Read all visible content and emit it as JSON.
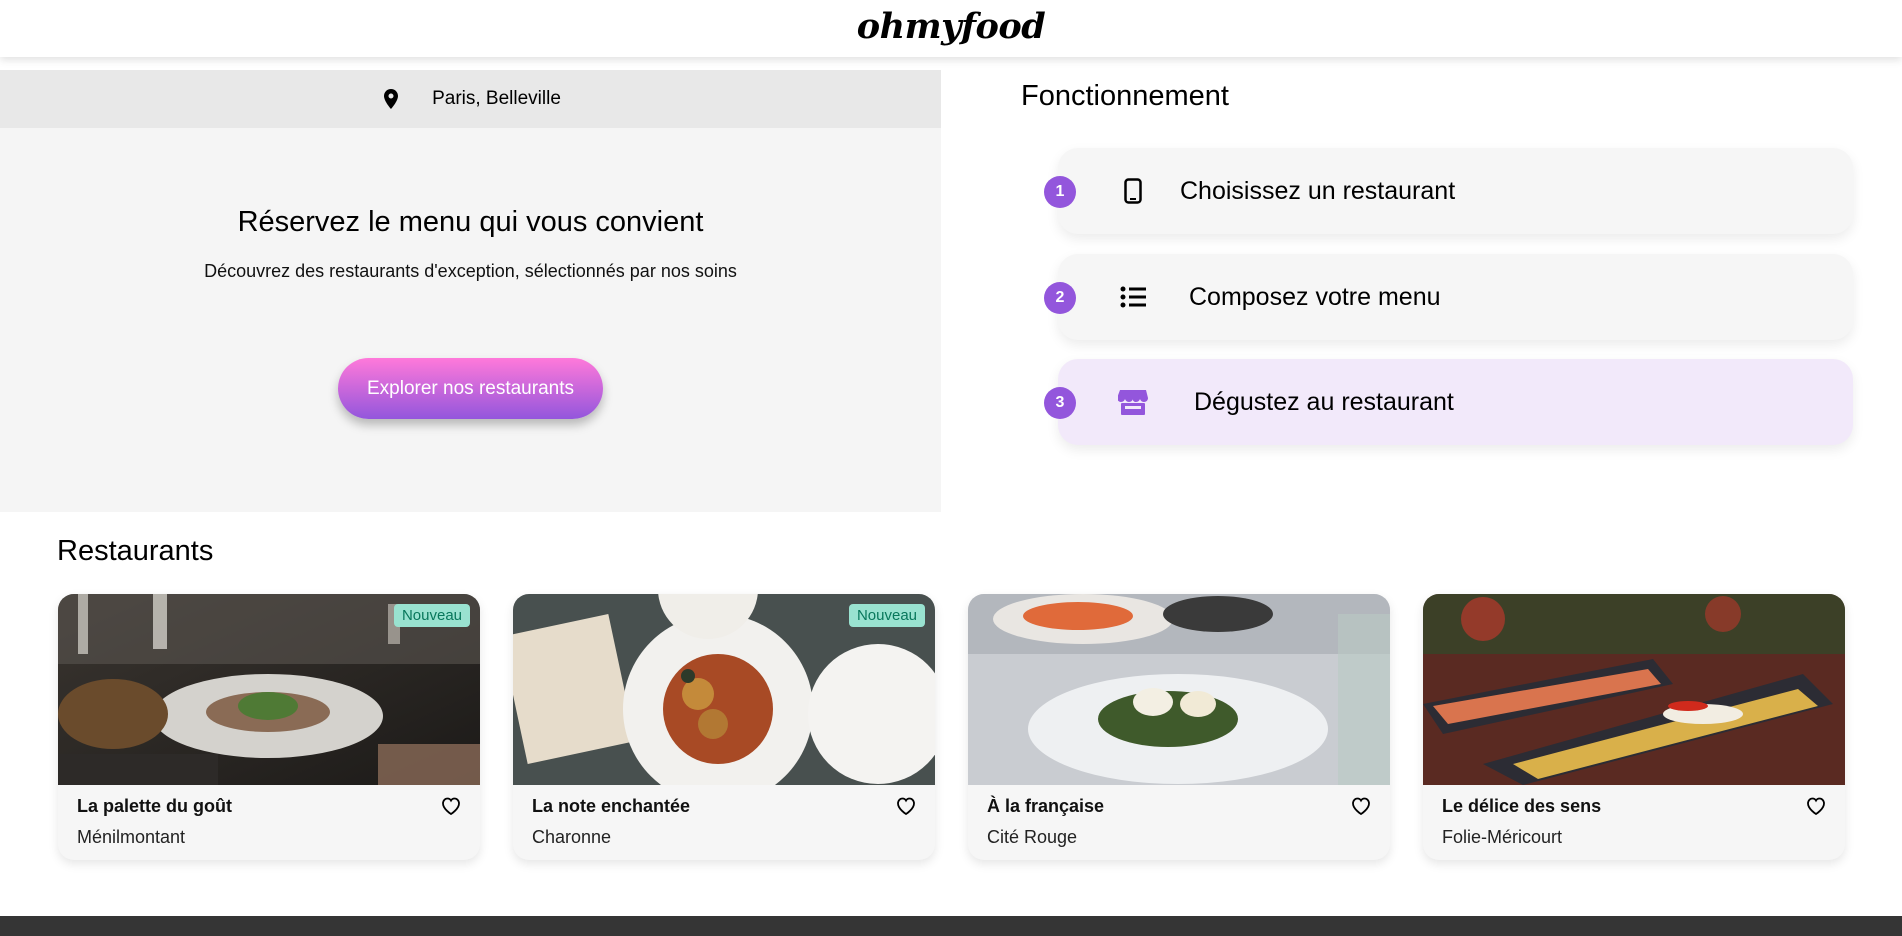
{
  "header": {
    "logo": "ohmyfood"
  },
  "hero": {
    "location": "Paris, Belleville",
    "title": "Réservez le menu qui vous convient",
    "subtitle": "Découvrez des restaurants d'exception, sélectionnés par nos soins",
    "cta_label": "Explorer nos restaurants"
  },
  "steps": {
    "title": "Fonctionnement",
    "items": [
      {
        "number": "1",
        "icon": "mobile-phone-icon",
        "label": "Choisissez un restaurant"
      },
      {
        "number": "2",
        "icon": "list-icon",
        "label": "Composez votre menu"
      },
      {
        "number": "3",
        "icon": "store-icon",
        "label": "Dégustez au restaurant"
      }
    ]
  },
  "restaurants": {
    "title": "Restaurants",
    "cards": [
      {
        "name": "La palette du goût",
        "area": "Ménilmontant",
        "badge": "Nouveau",
        "icon": "heart-icon"
      },
      {
        "name": "La note enchantée",
        "area": "Charonne",
        "badge": "Nouveau",
        "icon": "heart-icon"
      },
      {
        "name": "À la française",
        "area": "Cité Rouge",
        "badge": "",
        "icon": "heart-icon"
      },
      {
        "name": "Le délice des sens",
        "area": "Folie-Méricourt",
        "badge": "",
        "icon": "heart-icon"
      }
    ]
  },
  "colors": {
    "accent": "#9356dc",
    "gradient_start": "#ff79da",
    "gradient_end": "#9356dc",
    "badge_bg": "#99e2d0",
    "badge_text": "#08775b",
    "footer": "#353535"
  }
}
